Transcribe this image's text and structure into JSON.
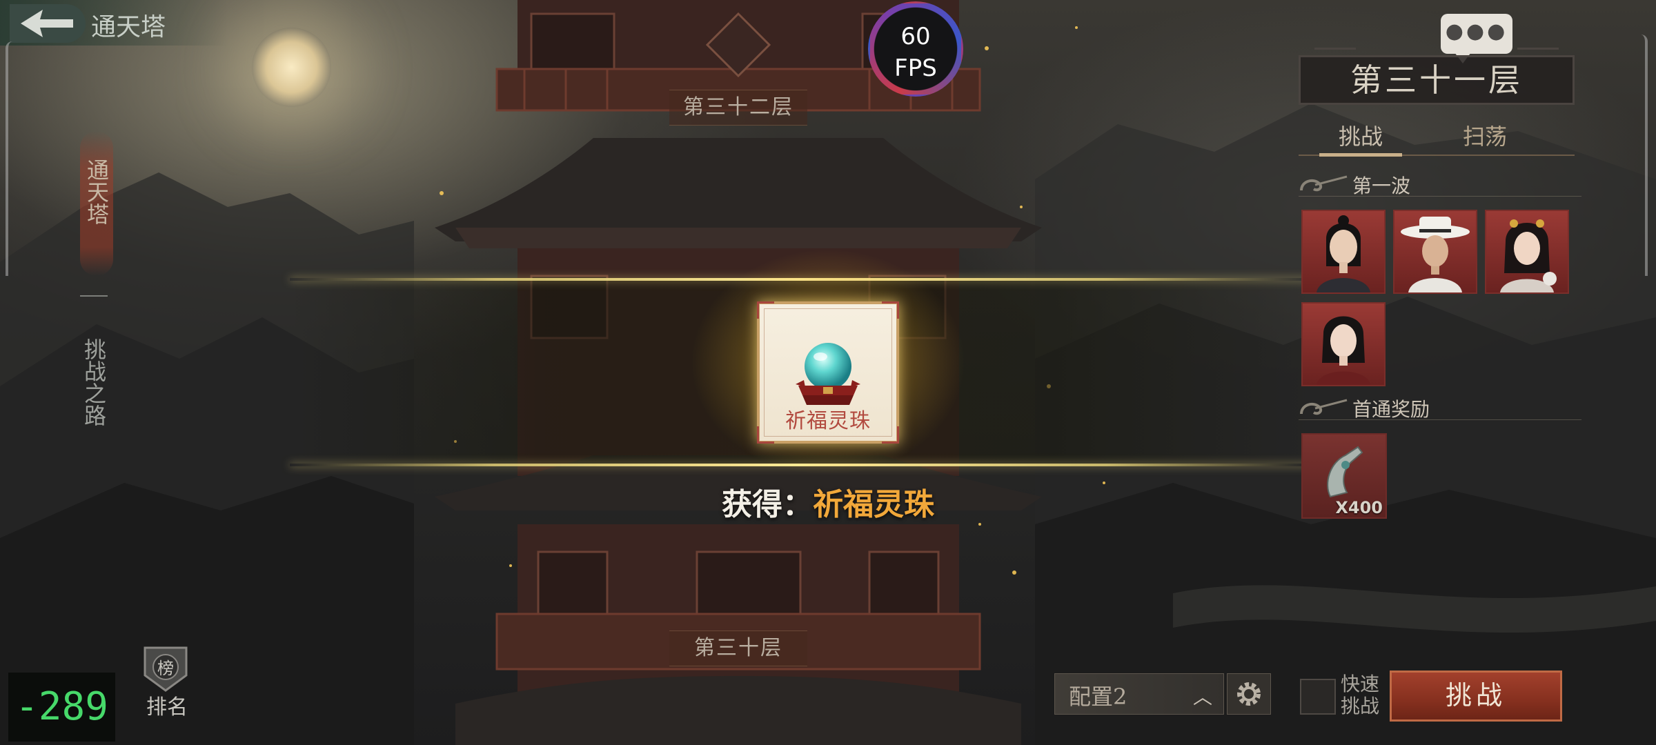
{
  "header": {
    "title": "通天塔"
  },
  "fps": {
    "value": "60",
    "unit": "FPS"
  },
  "left_nav": {
    "active_tab": "通天塔",
    "inactive_tab": "挑战之路"
  },
  "pagoda": {
    "floor_above": "第三十二层",
    "floor_below": "第三十层"
  },
  "reward_popup": {
    "item_name": "祈福灵珠",
    "obtain_prefix": "获得：",
    "obtain_item": "祈福灵珠"
  },
  "right_panel": {
    "floor_title": "第三十一层",
    "tabs": [
      {
        "label": "挑战",
        "active": true
      },
      {
        "label": "扫荡",
        "active": false
      }
    ],
    "wave_label": "第一波",
    "enemies": [
      {
        "icon": "portrait-young-man"
      },
      {
        "icon": "portrait-man-white-hat"
      },
      {
        "icon": "portrait-woman-ornate"
      },
      {
        "icon": "portrait-woman-plain"
      }
    ],
    "first_clear_label": "首通奖励",
    "first_clear_reward": {
      "icon": "jade-hook-icon",
      "quantity": "X400"
    }
  },
  "bottom": {
    "rank_badge_char": "榜",
    "rank_label": "排名",
    "debug_counter": "-289",
    "config_label": "配置2",
    "quick_label": "快速挑战",
    "challenge_label": "挑战"
  },
  "colors": {
    "accent_gold": "#f2a83a",
    "challenge_red": "#a2402c",
    "item_name_red": "#b24a3f",
    "debug_green": "#47d96a"
  }
}
